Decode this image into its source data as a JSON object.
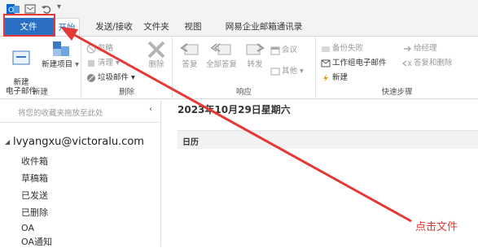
{
  "tabs": {
    "file": "文件",
    "home": "开始",
    "send_receive": "发送/接收",
    "folder": "文件夹",
    "view": "视图",
    "address_book": "网易企业邮箱通讯录"
  },
  "ribbon": {
    "new_email": "新建\n电子邮件",
    "new_item": "新建项目",
    "group_new": "新建",
    "ignore": "忽略",
    "cleanup": "清理",
    "junk": "垃圾邮件",
    "delete": "删除",
    "group_delete": "删除",
    "reply": "答复",
    "reply_all": "全部答复",
    "forward": "转发",
    "meeting": "会议",
    "more": "其他",
    "group_respond": "响应",
    "qs_failed": "备份失败",
    "qs_manager": "给经理",
    "qs_team_email": "工作组电子邮件",
    "qs_reply_delete": "答复和删除",
    "qs_new": "新建",
    "group_quicksteps": "快速步骤"
  },
  "nav": {
    "fav_hint": "将您的收藏夹拖放至此处",
    "account": "lvyangxu@victoralu.com",
    "folders": [
      "收件箱",
      "草稿箱",
      "已发送",
      "已删除",
      "OA",
      "OA通知"
    ]
  },
  "main": {
    "date": "2023年10月29日星期六",
    "calendar": "日历"
  },
  "annotation": {
    "click_file": "点击文件"
  },
  "colors": {
    "file_tab": "#2a6fc2",
    "annotation": "#e53935"
  }
}
